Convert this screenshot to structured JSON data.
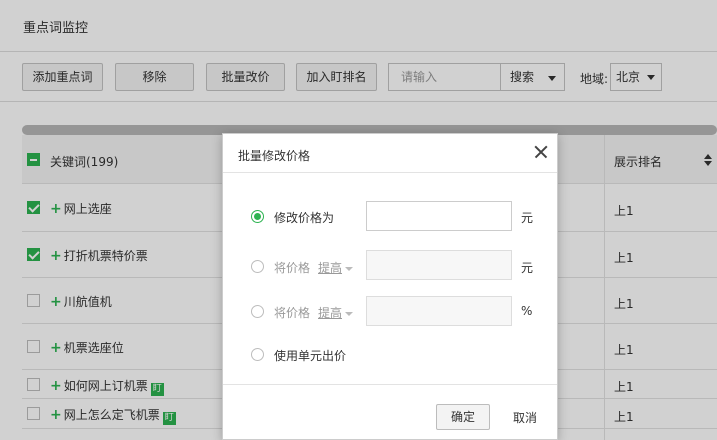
{
  "page": {
    "title": "重点词监控"
  },
  "toolbar": {
    "add_label": "添加重点词",
    "remove_label": "移除",
    "batch_price_label": "批量改价",
    "add_ding_label": "加入盯排名",
    "search_placeholder": "请输入",
    "search_type": "搜索",
    "region_label": "地域:",
    "region_value": "北京"
  },
  "table": {
    "header": {
      "keyword": "关键词(199)",
      "rank": "展示排名"
    },
    "rows": [
      {
        "keyword": "网上选座",
        "rank": "上1",
        "checked": true,
        "ding": false
      },
      {
        "keyword": "打折机票特价票",
        "rank": "上1",
        "checked": true,
        "ding": false
      },
      {
        "keyword": "川航值机",
        "rank": "上1",
        "checked": false,
        "ding": false
      },
      {
        "keyword": "机票选座位",
        "rank": "上1",
        "checked": false,
        "ding": false
      },
      {
        "keyword": "如何网上订机票",
        "rank": "上1",
        "checked": false,
        "ding": true
      },
      {
        "keyword": "网上怎么定飞机票",
        "rank": "上1",
        "checked": false,
        "ding": true
      }
    ],
    "plus_symbol": "+",
    "ding_badge": "盯"
  },
  "modal": {
    "title": "批量修改价格",
    "option1_label": "修改价格为",
    "option1_unit": "元",
    "option2_label": "将价格",
    "option2_link": "提高",
    "option2_unit": "元",
    "option3_label": "将价格",
    "option3_link": "提高",
    "option3_unit": "%",
    "option4_label": "使用单元出价",
    "ok_label": "确定",
    "cancel_label": "取消"
  },
  "colors": {
    "accent": "#2db351"
  }
}
